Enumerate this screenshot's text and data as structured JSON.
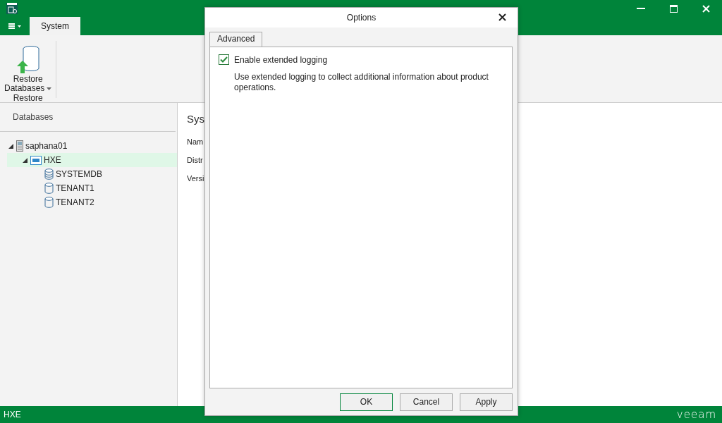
{
  "ribbon": {
    "tabs": [
      {
        "label": "System",
        "selected": true
      }
    ],
    "groups": [
      {
        "label": "Restore",
        "buttons": [
          {
            "label": "Restore Databases",
            "has_menu": true
          }
        ]
      }
    ]
  },
  "left_pane": {
    "title": "Databases",
    "tree": [
      {
        "label": "saphana01",
        "kind": "server",
        "expanded": true,
        "selected": false,
        "children": [
          {
            "label": "HXE",
            "kind": "instance",
            "expanded": true,
            "selected": true,
            "children": [
              {
                "label": "SYSTEMDB",
                "kind": "systemdb",
                "selected": false
              },
              {
                "label": "TENANT1",
                "kind": "tenant",
                "selected": false
              },
              {
                "label": "TENANT2",
                "kind": "tenant",
                "selected": false
              }
            ]
          }
        ]
      }
    ]
  },
  "right_pane": {
    "title": "Sys",
    "fields": [
      "Nam",
      "Distr",
      "Versi"
    ]
  },
  "dialog": {
    "title": "Options",
    "tabs": [
      {
        "label": "Advanced",
        "selected": true
      }
    ],
    "options": [
      {
        "label": "Enable extended logging",
        "checked": true,
        "description": "Use extended logging to collect additional information about product operations."
      }
    ],
    "buttons": [
      {
        "label": "OK",
        "default": true
      },
      {
        "label": "Cancel",
        "default": false
      },
      {
        "label": "Apply",
        "default": false
      }
    ]
  },
  "status_bar": {
    "text": "HXE",
    "logo": "veeam"
  }
}
